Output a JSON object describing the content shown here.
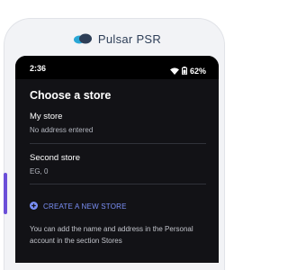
{
  "brand": {
    "name": "Pulsar PSR",
    "logo_icon": "cloud-logo-icon"
  },
  "status_bar": {
    "time": "2:36",
    "battery": "62%",
    "icons": [
      "wifi-icon",
      "battery-icon"
    ]
  },
  "sheet": {
    "title": "Choose a store",
    "stores": [
      {
        "name": "My store",
        "address": "No address entered"
      },
      {
        "name": "Second store",
        "address": "EG, 0"
      }
    ],
    "create_button": {
      "icon": "plus-circle-icon",
      "label": "CREATE A NEW STORE"
    },
    "info": "You can add the name and address in the Personal account in the section Stores"
  },
  "colors": {
    "accent": "#7a8ff6",
    "screen_bg": "#121216",
    "side_button": "#6b4fd8"
  }
}
